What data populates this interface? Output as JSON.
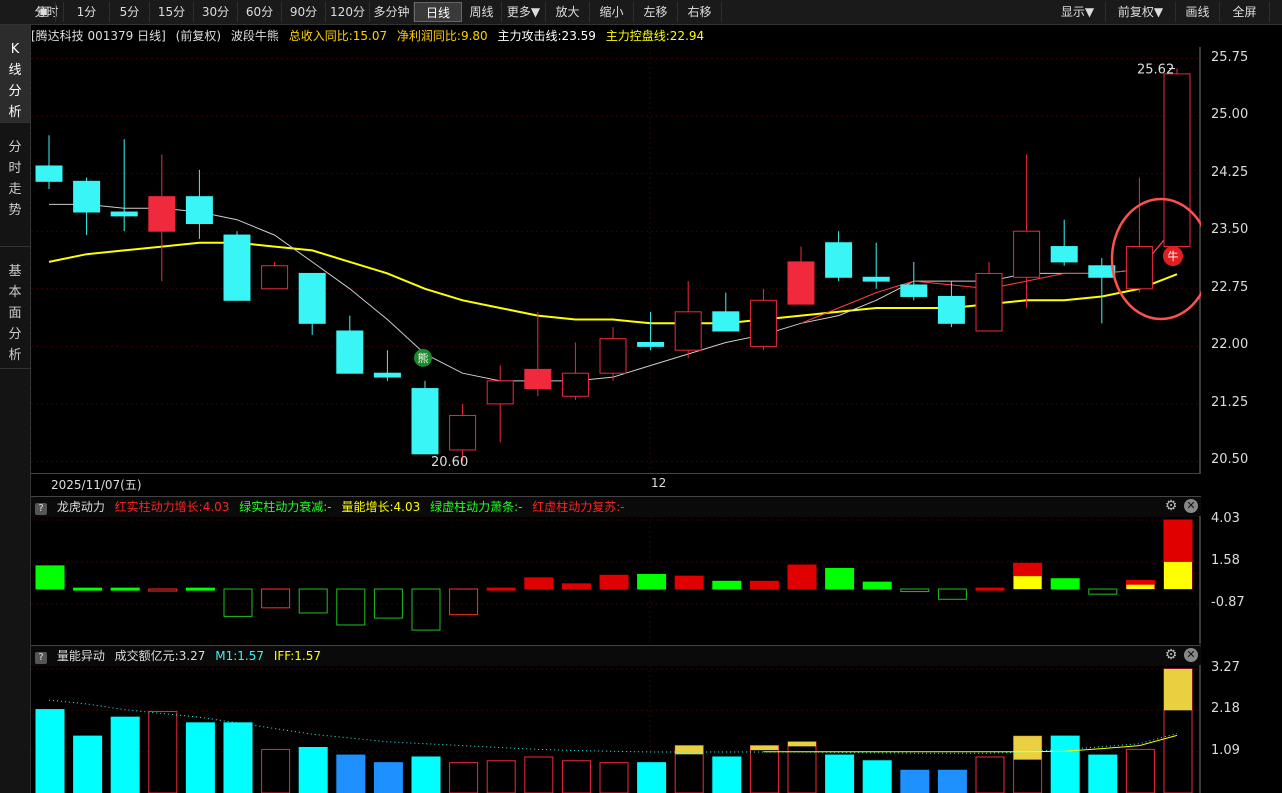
{
  "toolbar": {
    "items": [
      "分时",
      "1分",
      "5分",
      "15分",
      "30分",
      "60分",
      "90分",
      "120分",
      "多分钟",
      "日线",
      "周线",
      "更多▼",
      "放大",
      "缩小",
      "左移",
      "右移"
    ],
    "right_items": [
      "显示▼",
      "前复权▼",
      "画线",
      "全屏"
    ],
    "active": "日线"
  },
  "sidebar": {
    "items": [
      {
        "label": "K线分析",
        "chars": [
          "K",
          "线",
          "分",
          "析"
        ]
      },
      {
        "label": "分时走势",
        "chars": [
          "分",
          "时",
          "走",
          "势"
        ]
      },
      {
        "label": "基本面分析",
        "chars": [
          "基",
          "本",
          "面",
          "分",
          "析"
        ]
      }
    ]
  },
  "info": {
    "stock": "[腾达科技 001379 日线]",
    "adjust": "(前复权)",
    "indicator": "波段牛熊",
    "revenue": "总收入同比:15.07",
    "profit": "净利润同比:9.80",
    "attack": "主力攻击线:23.59",
    "control": "主力控盘线:22.94"
  },
  "colors": {
    "up": "#f0293d",
    "down": "#3af5f5",
    "ma_control": "#ffff00",
    "ma_attack": "#ff4040",
    "ma_white": "#cccccc",
    "grid": "#3a0000"
  },
  "price_axis": {
    "ticks": [
      "25.75",
      "25.00",
      "24.25",
      "23.50",
      "22.75",
      "22.00",
      "21.25",
      "20.50"
    ]
  },
  "date_labels": {
    "start": "2025/11/07(五)",
    "mid": "12"
  },
  "annotations": {
    "high": "25.62",
    "low": "20.60",
    "bear": "熊",
    "bull": "牛"
  },
  "panel2": {
    "name": "龙虎动力",
    "f1": "红实柱动力增长:4.03",
    "f2": "绿实柱动力衰减:-",
    "f3": "量能增长:4.03",
    "f4": "绿虚柱动力萧条:-",
    "f5": "红虚柱动力复苏:-",
    "ticks": [
      "4.03",
      "1.58",
      "-0.87"
    ]
  },
  "panel3": {
    "name": "量能异动",
    "amount": "成交额亿元:3.27",
    "m1": "M1:1.57",
    "iff": "IFF:1.57",
    "ticks": [
      "3.27",
      "2.18",
      "1.09"
    ]
  },
  "chart_data": {
    "type": "candlestick",
    "ylim": [
      20.35,
      25.9
    ],
    "candles": [
      {
        "o": 24.35,
        "h": 24.75,
        "l": 24.05,
        "c": 24.15
      },
      {
        "o": 24.15,
        "h": 24.2,
        "l": 23.45,
        "c": 23.75
      },
      {
        "o": 23.75,
        "h": 24.7,
        "l": 23.5,
        "c": 23.7
      },
      {
        "o": 23.5,
        "h": 24.5,
        "l": 22.85,
        "c": 23.95
      },
      {
        "o": 23.95,
        "h": 24.3,
        "l": 23.4,
        "c": 23.6
      },
      {
        "o": 23.45,
        "h": 23.5,
        "l": 22.6,
        "c": 22.6
      },
      {
        "o": 22.75,
        "h": 23.1,
        "l": 22.75,
        "c": 23.05
      },
      {
        "o": 22.95,
        "h": 22.95,
        "l": 22.15,
        "c": 22.3
      },
      {
        "o": 22.2,
        "h": 22.4,
        "l": 21.65,
        "c": 21.65
      },
      {
        "o": 21.65,
        "h": 21.95,
        "l": 21.55,
        "c": 21.6
      },
      {
        "o": 21.45,
        "h": 21.55,
        "l": 20.6,
        "c": 20.6
      },
      {
        "o": 20.65,
        "h": 21.25,
        "l": 20.5,
        "c": 21.1
      },
      {
        "o": 21.25,
        "h": 21.75,
        "l": 20.75,
        "c": 21.55
      },
      {
        "o": 21.45,
        "h": 22.45,
        "l": 21.35,
        "c": 21.7
      },
      {
        "o": 21.35,
        "h": 22.05,
        "l": 21.3,
        "c": 21.65
      },
      {
        "o": 21.65,
        "h": 22.25,
        "l": 21.55,
        "c": 22.1
      },
      {
        "o": 22.05,
        "h": 22.45,
        "l": 21.95,
        "c": 22.0
      },
      {
        "o": 21.95,
        "h": 22.85,
        "l": 21.85,
        "c": 22.45
      },
      {
        "o": 22.45,
        "h": 22.7,
        "l": 22.2,
        "c": 22.2
      },
      {
        "o": 22.0,
        "h": 22.75,
        "l": 21.95,
        "c": 22.6
      },
      {
        "o": 22.55,
        "h": 23.3,
        "l": 22.55,
        "c": 23.1
      },
      {
        "o": 23.35,
        "h": 23.5,
        "l": 22.85,
        "c": 22.9
      },
      {
        "o": 22.9,
        "h": 23.35,
        "l": 22.75,
        "c": 22.85
      },
      {
        "o": 22.8,
        "h": 23.1,
        "l": 22.6,
        "c": 22.65
      },
      {
        "o": 22.65,
        "h": 22.85,
        "l": 22.25,
        "c": 22.3
      },
      {
        "o": 22.2,
        "h": 23.1,
        "l": 22.2,
        "c": 22.95
      },
      {
        "o": 22.9,
        "h": 24.5,
        "l": 22.5,
        "c": 23.5
      },
      {
        "o": 23.3,
        "h": 23.65,
        "l": 23.05,
        "c": 23.1
      },
      {
        "o": 23.05,
        "h": 23.15,
        "l": 22.3,
        "c": 22.9
      },
      {
        "o": 22.75,
        "h": 24.2,
        "l": 22.7,
        "c": 23.3
      },
      {
        "o": 23.3,
        "h": 25.62,
        "l": 23.3,
        "c": 25.55
      }
    ],
    "ma_white": [
      23.85,
      23.85,
      23.8,
      23.8,
      23.75,
      23.65,
      23.45,
      23.1,
      22.75,
      22.35,
      21.9,
      21.65,
      21.55,
      21.55,
      21.55,
      21.6,
      21.75,
      21.9,
      22.05,
      22.15,
      22.3,
      22.4,
      22.6,
      22.85,
      22.85,
      22.85,
      22.95,
      22.95,
      22.95,
      23.0,
      23.59
    ],
    "ma_red": [
      null,
      null,
      null,
      null,
      null,
      null,
      null,
      null,
      null,
      null,
      null,
      null,
      null,
      null,
      null,
      null,
      null,
      null,
      null,
      null,
      22.3,
      22.5,
      22.7,
      22.85,
      22.8,
      22.75,
      22.85,
      22.95,
      22.95,
      23.0,
      23.59
    ],
    "ma_yellow": [
      23.1,
      23.2,
      23.25,
      23.3,
      23.35,
      23.35,
      23.3,
      23.25,
      23.1,
      22.95,
      22.75,
      22.6,
      22.5,
      22.4,
      22.35,
      22.35,
      22.3,
      22.3,
      22.3,
      22.35,
      22.4,
      22.45,
      22.5,
      22.5,
      22.5,
      22.55,
      22.6,
      22.6,
      22.65,
      22.75,
      22.94
    ],
    "power": [
      1.35,
      0.05,
      0.05,
      -0.1,
      0.05,
      -1.6,
      -1.1,
      -1.4,
      -2.1,
      -1.7,
      -2.4,
      -1.5,
      0.05,
      0.65,
      0.3,
      0.8,
      0.85,
      0.75,
      0.45,
      0.45,
      1.4,
      1.2,
      0.4,
      -0.15,
      -0.6,
      0.05,
      1.5,
      0.6,
      -0.3,
      0.5,
      4.03
    ],
    "power_yellow": [
      0,
      0,
      0,
      0,
      0,
      0,
      0,
      0,
      0,
      0,
      0,
      0,
      0,
      0,
      0,
      0,
      0,
      0,
      0,
      0,
      0,
      0,
      0,
      0,
      0,
      0,
      0.75,
      0,
      0,
      0.25,
      1.58
    ],
    "volume": [
      2.2,
      1.5,
      2.0,
      2.15,
      1.85,
      1.85,
      1.15,
      1.2,
      1.0,
      0.8,
      0.95,
      0.8,
      0.85,
      0.95,
      0.85,
      0.8,
      0.8,
      1.25,
      0.95,
      1.25,
      1.35,
      1.0,
      0.85,
      0.6,
      0.6,
      0.95,
      1.5,
      1.5,
      1.0,
      1.15,
      3.27
    ],
    "volume_yellow": [
      0,
      0,
      0,
      0,
      0,
      0,
      0,
      0,
      0,
      0,
      0,
      0,
      0,
      0,
      0,
      0,
      0,
      0.23,
      0,
      0.12,
      0.12,
      0,
      0,
      0,
      0,
      0,
      0.62,
      0,
      0,
      0,
      1.09
    ],
    "volume_m1": [
      2.45,
      2.35,
      2.2,
      2.1,
      2.0,
      1.85,
      1.7,
      1.55,
      1.45,
      1.35,
      1.3,
      1.25,
      1.2,
      1.15,
      1.12,
      1.1,
      1.08,
      1.08,
      1.08,
      1.08,
      1.08,
      1.07,
      1.06,
      1.05,
      1.05,
      1.05,
      1.08,
      1.15,
      1.22,
      1.3,
      1.57
    ]
  }
}
